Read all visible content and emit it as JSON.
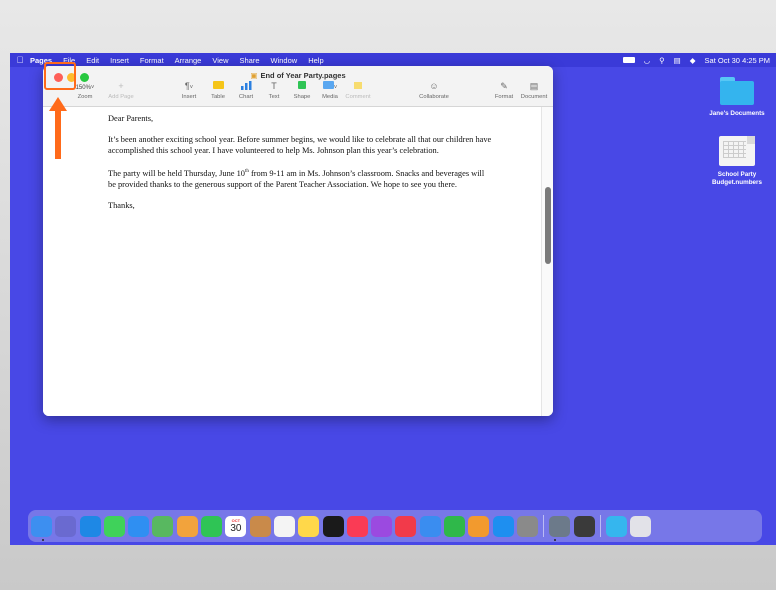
{
  "menubar": {
    "apple_icon": "apple-logo-icon",
    "items": [
      "Pages",
      "File",
      "Edit",
      "Insert",
      "Format",
      "Arrange",
      "View",
      "Share",
      "Window",
      "Help"
    ],
    "datetime": "Sat Oct 30  4:25 PM",
    "status_icons": [
      "battery-icon",
      "wifi-icon",
      "search-icon",
      "control-center-icon",
      "siri-icon"
    ]
  },
  "window": {
    "title": "End of Year Party.pages",
    "toolbar": {
      "zoom_value": "150%",
      "zoom_label": "Zoom",
      "add_page_label": "Add Page",
      "insert_label": "Insert",
      "table_label": "Table",
      "chart_label": "Chart",
      "text_label": "Text",
      "shape_label": "Shape",
      "media_label": "Media",
      "comment_label": "Comment",
      "collaborate_label": "Collaborate",
      "format_label": "Format",
      "document_label": "Document"
    },
    "document": {
      "greeting": "Dear Parents,",
      "paragraph1": "It’s been another exciting school year. Before summer begins, we would like to celebrate all that our children have accomplished this school year. I have volunteered to help Ms. Johnson plan this year’s celebration.",
      "p2_before": "The party will be held Thursday, June 10",
      "p2_sup": "th",
      "p2_after": " from 9-11 am in Ms. Johnson’s classroom. Snacks and beverages will be provided thanks to the generous support of the Parent Teacher Association. We hope to see you there.",
      "closing": "Thanks,"
    }
  },
  "desktop": {
    "items": [
      {
        "label": "Jane's Documents",
        "icon": "folder-icon"
      },
      {
        "label": "School Party Budget.numbers",
        "icon": "numbers-file-icon"
      }
    ]
  },
  "dock": {
    "apps": [
      {
        "name": "finder",
        "color": "#3d8ff0"
      },
      {
        "name": "launchpad",
        "color": "#6a6ad0"
      },
      {
        "name": "safari",
        "color": "#1e88e5"
      },
      {
        "name": "messages",
        "color": "#3fd25a"
      },
      {
        "name": "mail",
        "color": "#2f8ff2"
      },
      {
        "name": "maps",
        "color": "#58b860"
      },
      {
        "name": "photos",
        "color": "#f2a33c"
      },
      {
        "name": "facetime",
        "color": "#2fc455"
      },
      {
        "name": "calendar",
        "color": "#ffffff"
      },
      {
        "name": "contacts",
        "color": "#c98a4a"
      },
      {
        "name": "reminders",
        "color": "#f4f4f4"
      },
      {
        "name": "notes",
        "color": "#ffd84a"
      },
      {
        "name": "tv",
        "color": "#1a1a1a"
      },
      {
        "name": "music",
        "color": "#fa3b55"
      },
      {
        "name": "podcasts",
        "color": "#9b4ae0"
      },
      {
        "name": "news",
        "color": "#f23a4a"
      },
      {
        "name": "keynote",
        "color": "#3a8df0"
      },
      {
        "name": "numbers",
        "color": "#2fb84a"
      },
      {
        "name": "pages",
        "color": "#f29a2e"
      },
      {
        "name": "app-store",
        "color": "#1e8ff0"
      },
      {
        "name": "system-preferences",
        "color": "#8a8a8a"
      }
    ],
    "extras": [
      {
        "name": "preview",
        "color": "#6c7a8a"
      },
      {
        "name": "calculator",
        "color": "#3a3a3a"
      }
    ],
    "trash_items": [
      {
        "name": "downloads-folder",
        "color": "#35b6ee"
      },
      {
        "name": "trash",
        "color": "#e2e2e8"
      }
    ],
    "calendar_month": "OCT",
    "calendar_day": "30"
  },
  "annotation": {
    "highlight_color": "#ff6a1a"
  }
}
